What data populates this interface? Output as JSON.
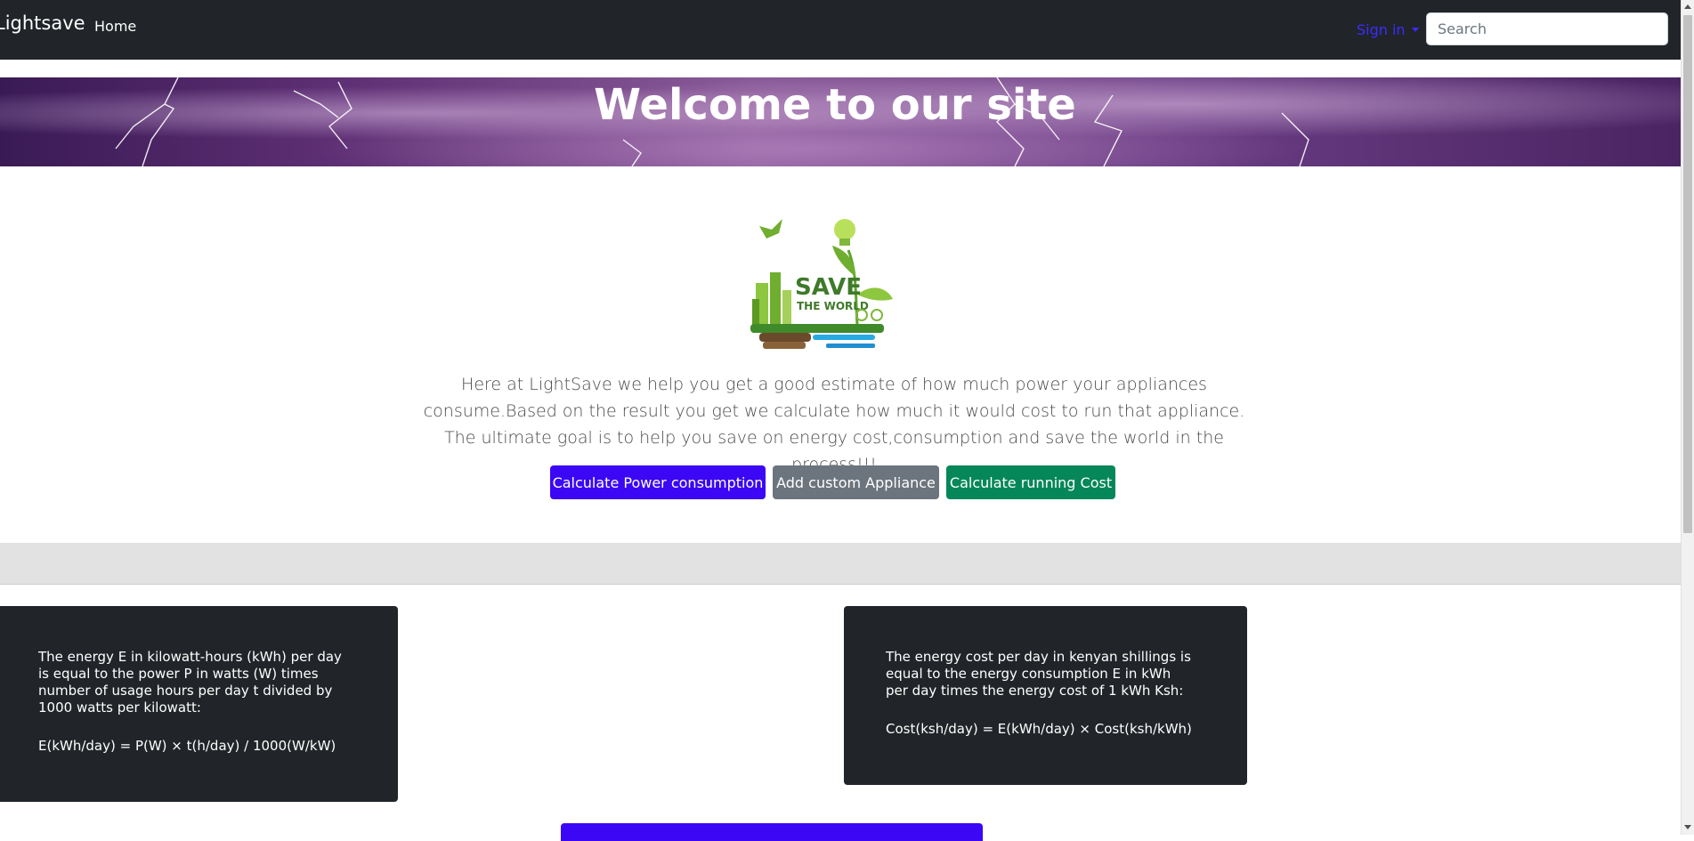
{
  "nav": {
    "brand": "Lightsave",
    "home": "Home",
    "signin": "Sign in",
    "search_placeholder": "Search"
  },
  "hero": {
    "title": "Welcome to our site"
  },
  "logo": {
    "line1": "SAVE",
    "line2": "THE WORLD"
  },
  "intro": {
    "text": "Here at LightSave we help you get a good estimate of how much power your appliances consume.Based on the result you get we calculate how much it would cost to run that appliance. The ultimate goal is to help you save on energy cost,consumption and save the world in the process!!!"
  },
  "buttons": {
    "power": "Calculate Power consumption",
    "custom": "Add custom Appliance",
    "cost": "Calculate running Cost"
  },
  "cards": {
    "energy": {
      "description": "The energy E in kilowatt-hours (kWh) per day is equal to the power P in watts (W) times number of usage hours per day t divided by 1000 watts per kilowatt:",
      "formula": "E(kWh/day) = P(W) × t(h/day) / 1000(W/kW)"
    },
    "cost": {
      "description": "The energy cost per day in kenyan shillings is equal to the energy consumption E in kWh per day times the energy cost of 1 kWh Ksh:",
      "formula": "Cost(ksh/day) = E(kWh/day) × Cost(ksh/kWh)"
    }
  },
  "colors": {
    "navbar": "#212529",
    "primary": "#3b07f5",
    "secondary": "#6c757d",
    "success": "#05875a",
    "signin": "#3b2bff"
  }
}
